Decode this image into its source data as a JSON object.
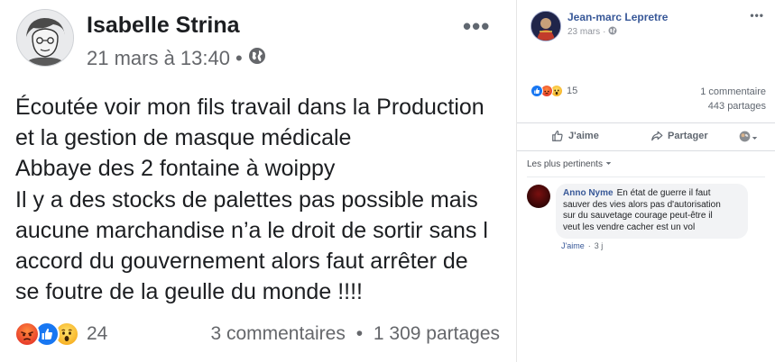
{
  "left_post": {
    "author": "Isabelle Strina",
    "timestamp": "21 mars à 13:40",
    "privacy_icon": "globe-icon",
    "more_icon": "more-options-icon",
    "text_lines": [
      "Écoutée voir mon fils travail dans la Production",
      "et la gestion de masque médicale",
      "Abbaye des 2 fontaine à woippy",
      "Il y a des stocks de palettes pas possible mais",
      "aucune marchandise n’a le droit de sortir sans l",
      "accord du gouvernement alors faut arrêter de",
      "se foutre de la geulle du monde !!!!"
    ],
    "reactions": [
      "angry",
      "like",
      "wow"
    ],
    "reaction_count": "24",
    "comments": "3 commentaires",
    "shares": "1 309 partages"
  },
  "right_post": {
    "author": "Jean-marc Lepretre",
    "timestamp": "23 mars",
    "privacy_icon": "globe-icon",
    "more_icon": "more-options-icon",
    "reactions": [
      "like",
      "angry",
      "wow"
    ],
    "reaction_count": "15",
    "comments": "1 commentaire",
    "shares": "443 partages",
    "actions": {
      "like_label": "J'aime",
      "share_label": "Partager"
    },
    "sort_label": "Les plus pertinents",
    "comment": {
      "author": "Anno Nyme",
      "lines": [
        "En état de guerre il faut",
        "sauver des vies alors pas d'autorisation",
        "sur du sauvetage courage peut-être il",
        "veut les vendre cacher est un vol"
      ],
      "like_label": "J'aime",
      "age": "3 j"
    }
  },
  "colors": {
    "facebook_blue": "#385898",
    "like_blue": "#1877f2",
    "angry_orange": "#e9422c",
    "wow_yellow": "#f7b125",
    "muted_text": "#65676b"
  }
}
